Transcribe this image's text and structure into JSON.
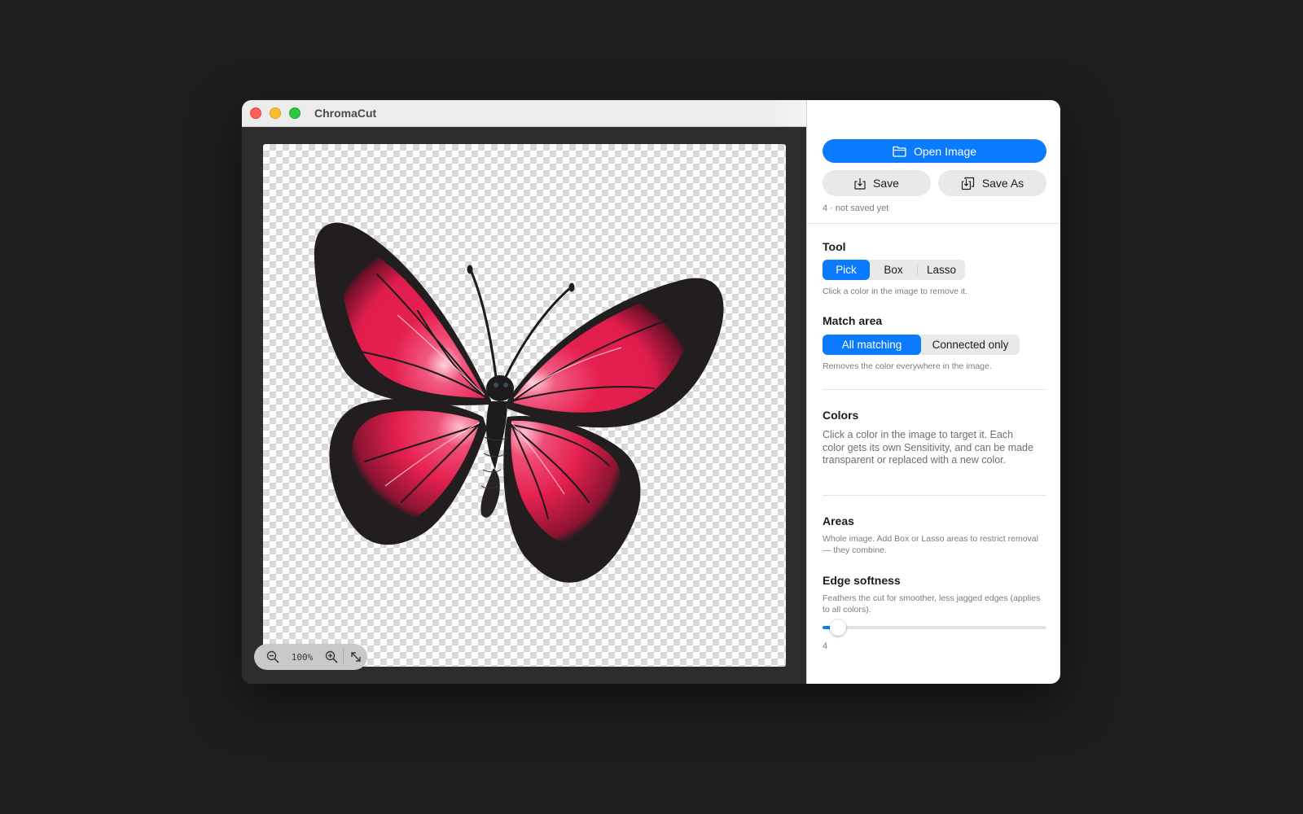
{
  "window": {
    "title": "ChromaCut",
    "controls": [
      "close",
      "minimize",
      "zoom"
    ]
  },
  "canvas": {
    "zoom_label": "100%",
    "zoom_controls": {
      "zoom_out_icon": "magnifier-minus-icon",
      "zoom_in_icon": "magnifier-plus-icon",
      "fit_icon": "expand-arrows-icon"
    },
    "image_subject": "butterfly"
  },
  "sidebar": {
    "open_image_label": "Open Image",
    "save_label": "Save",
    "save_as_label": "Save As",
    "status": "4 · not saved yet",
    "tool": {
      "title": "Tool",
      "options": [
        "Pick",
        "Box",
        "Lasso"
      ],
      "selected": "Pick",
      "hint": "Click a color in the image to remove it."
    },
    "match_area": {
      "title": "Match area",
      "options": [
        "All matching",
        "Connected only"
      ],
      "selected": "All matching",
      "hint": "Removes the color everywhere in the image."
    },
    "colors": {
      "title": "Colors",
      "text": "Click a color in the image to target it. Each color gets its own Sensitivity, and can be made transparent or replaced with a new color."
    },
    "areas": {
      "title": "Areas",
      "text": "Whole image. Add Box or Lasso areas to restrict removal — they combine."
    },
    "edge_softness": {
      "title": "Edge softness",
      "hint": "Feathers the cut for smoother, less jagged edges (applies to all colors).",
      "value": 4,
      "value_label": "4",
      "fraction": 0.07
    }
  },
  "colors": {
    "accent": "#0a7aff",
    "wing_pink": "#e5204f",
    "wing_border": "#221e1f"
  }
}
